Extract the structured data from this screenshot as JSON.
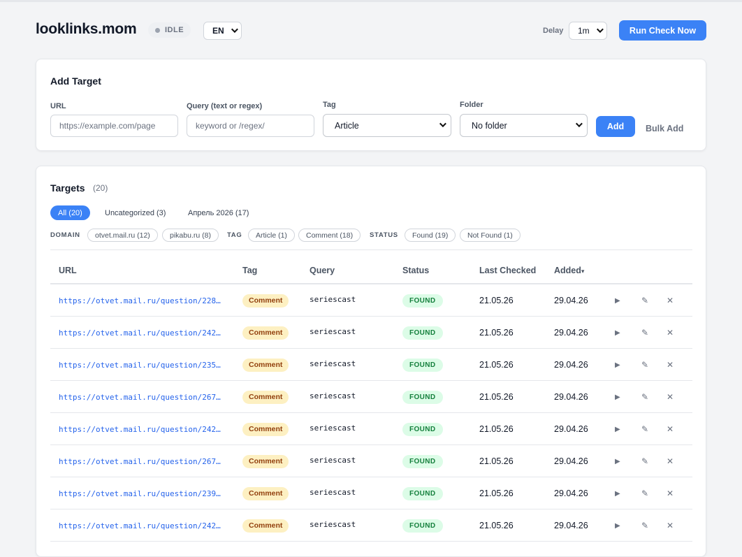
{
  "header": {
    "brand": "looklinks.mom",
    "status": "IDLE",
    "language": "EN",
    "delay_label": "Delay",
    "delay_value": "1m",
    "run_button": "Run Check Now"
  },
  "add_target": {
    "title": "Add Target",
    "url_label": "URL",
    "url_placeholder": "https://example.com/page",
    "query_label": "Query (text or regex)",
    "query_placeholder": "keyword or /regex/",
    "tag_label": "Tag",
    "tag_value": "Article",
    "folder_label": "Folder",
    "folder_value": "No folder",
    "add_button": "Add",
    "bulk_button": "Bulk Add"
  },
  "targets": {
    "title": "Targets",
    "count": "(20)",
    "folders": [
      "All (20)",
      "Uncategorized (3)",
      "Апрель 2026 (17)"
    ],
    "filters": {
      "domain_label": "DOMAIN",
      "domains": [
        "otvet.mail.ru (12)",
        "pikabu.ru (8)"
      ],
      "tag_label": "TAG",
      "tags": [
        "Article (1)",
        "Comment (18)"
      ],
      "status_label": "STATUS",
      "statuses": [
        "Found (19)",
        "Not Found (1)"
      ]
    },
    "columns": {
      "url": "URL",
      "tag": "Tag",
      "query": "Query",
      "status": "Status",
      "last_checked": "Last Checked",
      "added": "Added",
      "sort_indicator": "▾"
    },
    "action_icons": {
      "run": "▶",
      "edit": "✎",
      "delete": "✕"
    },
    "rows": [
      {
        "url": "https://otvet.mail.ru/question/228…",
        "tag": "Comment",
        "query": "seriescast",
        "status": "FOUND",
        "last_checked": "21.05.26",
        "added": "29.04.26"
      },
      {
        "url": "https://otvet.mail.ru/question/242…",
        "tag": "Comment",
        "query": "seriescast",
        "status": "FOUND",
        "last_checked": "21.05.26",
        "added": "29.04.26"
      },
      {
        "url": "https://otvet.mail.ru/question/235…",
        "tag": "Comment",
        "query": "seriescast",
        "status": "FOUND",
        "last_checked": "21.05.26",
        "added": "29.04.26"
      },
      {
        "url": "https://otvet.mail.ru/question/267…",
        "tag": "Comment",
        "query": "seriescast",
        "status": "FOUND",
        "last_checked": "21.05.26",
        "added": "29.04.26"
      },
      {
        "url": "https://otvet.mail.ru/question/242…",
        "tag": "Comment",
        "query": "seriescast",
        "status": "FOUND",
        "last_checked": "21.05.26",
        "added": "29.04.26"
      },
      {
        "url": "https://otvet.mail.ru/question/267…",
        "tag": "Comment",
        "query": "seriescast",
        "status": "FOUND",
        "last_checked": "21.05.26",
        "added": "29.04.26"
      },
      {
        "url": "https://otvet.mail.ru/question/239…",
        "tag": "Comment",
        "query": "seriescast",
        "status": "FOUND",
        "last_checked": "21.05.26",
        "added": "29.04.26"
      },
      {
        "url": "https://otvet.mail.ru/question/242…",
        "tag": "Comment",
        "query": "seriescast",
        "status": "FOUND",
        "last_checked": "21.05.26",
        "added": "29.04.26"
      }
    ]
  },
  "colors": {
    "accent": "#3b82f6",
    "found_bg": "#dcfce7",
    "found_text": "#15803d",
    "comment_bg": "#fdf0c2",
    "link": "#2563eb"
  }
}
